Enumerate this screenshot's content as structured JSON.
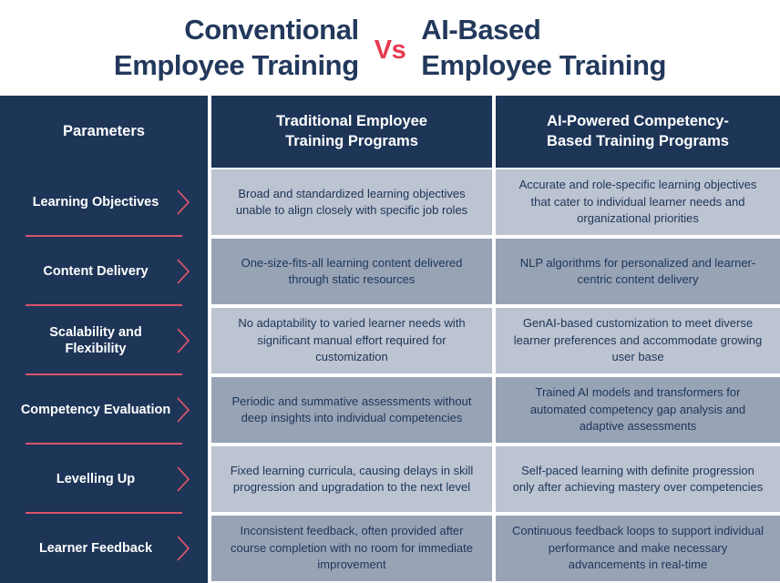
{
  "title": {
    "left_line1": "Conventional",
    "left_line2": "Employee Training",
    "vs": "Vs",
    "right_line1": "AI-Based",
    "right_line2": "Employee Training"
  },
  "colors": {
    "navy": "#1d3557",
    "title_navy": "#22395c",
    "accent_red": "#e63950",
    "rule_red": "#d9546a",
    "row_light": "#bcc3d1",
    "row_dark": "#98a3b6",
    "white": "#ffffff"
  },
  "table": {
    "headers": {
      "parameters": "Parameters",
      "col_a_line1": "Traditional Employee",
      "col_a_line2": "Training Programs",
      "col_b_line1": "AI-Powered Competency-",
      "col_b_line2": "Based Training Programs"
    },
    "rows": [
      {
        "parameter": "Learning Objectives",
        "traditional": "Broad and standardized learning objectives unable to align closely with specific job roles",
        "ai_based": "Accurate and role-specific learning objectives that cater to individual learner needs and organizational priorities"
      },
      {
        "parameter": "Content Delivery",
        "traditional": "One-size-fits-all learning content delivered through static resources",
        "ai_based": "NLP algorithms for personalized and learner-centric content delivery"
      },
      {
        "parameter": "Scalability and Flexibility",
        "traditional": "No adaptability to varied learner needs with significant manual effort required for customization",
        "ai_based": "GenAI-based customization to meet diverse learner preferences and accommodate growing user base"
      },
      {
        "parameter": "Competency Evaluation",
        "traditional": "Periodic and summative assessments without deep insights into individual competencies",
        "ai_based": "Trained AI models and transformers for automated competency gap analysis and adaptive assessments"
      },
      {
        "parameter": "Levelling Up",
        "traditional": "Fixed learning curricula, causing delays in skill progression and upgradation to the next level",
        "ai_based": "Self-paced learning with definite progression only after achieving mastery over competencies"
      },
      {
        "parameter": "Learner Feedback",
        "traditional": "Inconsistent feedback, often provided after course completion with no room for immediate improvement",
        "ai_based": "Continuous feedback loops to support individual performance and make necessary advancements in real-time"
      }
    ]
  }
}
